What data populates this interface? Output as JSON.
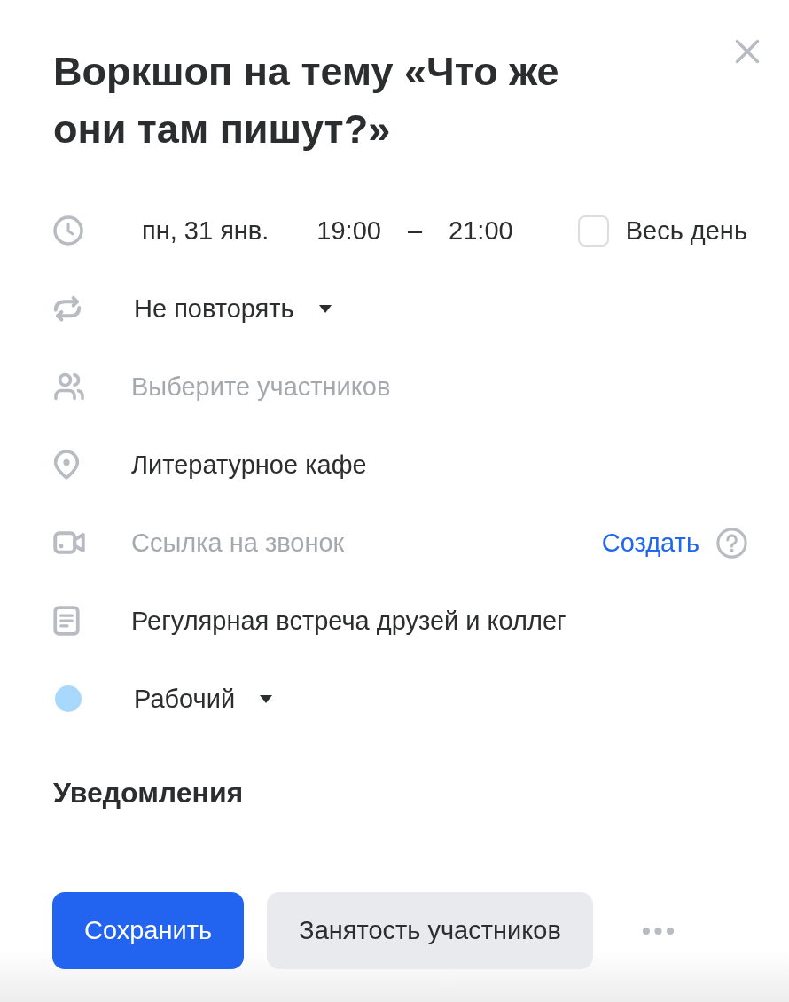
{
  "dialog": {
    "title": "Воркшоп на тему «Что же они там пишут?»"
  },
  "datetime": {
    "date": "пн, 31 янв.",
    "start": "19:00",
    "separator": "–",
    "end": "21:00",
    "all_day": {
      "label": "Весь день",
      "checked": false
    }
  },
  "repeat": {
    "value": "Не повторять"
  },
  "participants": {
    "placeholder": "Выберите участников"
  },
  "location": {
    "value": "Литературное кафе"
  },
  "call_link": {
    "placeholder": "Ссылка на звонок",
    "action": "Создать"
  },
  "description": {
    "value": "Регулярная встреча друзей и коллег"
  },
  "calendar": {
    "value": "Рабочий",
    "color": "#a8d8fc"
  },
  "notifications": {
    "title": "Уведомления"
  },
  "buttons": [
    {
      "kind": "primary",
      "label": "Сохранить"
    },
    {
      "kind": "secondary",
      "label": "Занятость участников"
    }
  ]
}
